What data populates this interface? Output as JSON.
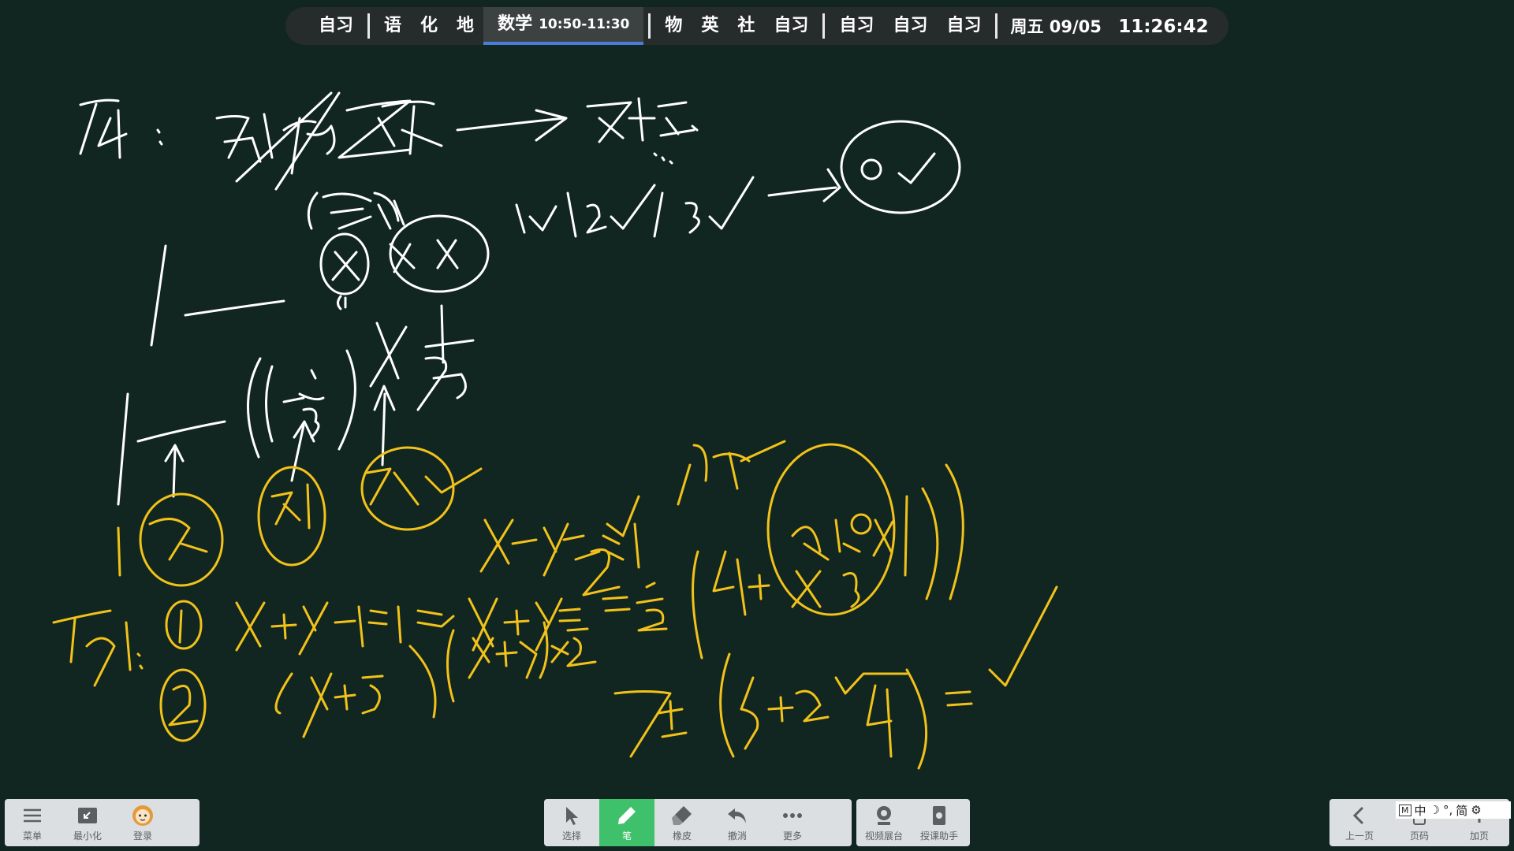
{
  "schedule": {
    "slots": [
      "自习",
      "语",
      "化",
      "地",
      "物",
      "英",
      "社",
      "自习",
      "自习",
      "自习",
      "自习"
    ],
    "current": {
      "subject": "数学",
      "time": "10:50-11:30"
    },
    "date": "周五 09/05",
    "clock": "11:26:42"
  },
  "colors": {
    "board": "#112620",
    "chalk_white": "#ffffff",
    "chalk_yellow": "#f2c21a",
    "active_tool": "#3fc06a",
    "progress_accent": "#4a7cd8"
  },
  "left_toolbar": [
    {
      "label": "菜单",
      "icon": "menu-icon"
    },
    {
      "label": "最小化",
      "icon": "minimize-icon"
    },
    {
      "label": "登录",
      "icon": "avatar-icon"
    }
  ],
  "center_toolbar": [
    {
      "label": "选择",
      "icon": "cursor-icon"
    },
    {
      "label": "笔",
      "icon": "pen-icon",
      "active": true
    },
    {
      "label": "橡皮",
      "icon": "eraser-icon"
    },
    {
      "label": "撤消",
      "icon": "undo-icon"
    },
    {
      "label": "更多",
      "icon": "more-icon"
    }
  ],
  "right_center_toolbar": [
    {
      "label": "视频展台",
      "icon": "camera-icon"
    },
    {
      "label": "授课助手",
      "icon": "tablet-icon"
    }
  ],
  "page_toolbar": [
    {
      "label": "上一页",
      "icon": "chevron-left-icon"
    },
    {
      "label": "页码",
      "icon": "page-number-icon"
    },
    {
      "label": "加页",
      "icon": "add-page-icon"
    }
  ],
  "ime": {
    "mode_box": "M",
    "lang": "中",
    "moon": "☽",
    "punct": "°,",
    "script": "简",
    "gear": "⚙"
  }
}
